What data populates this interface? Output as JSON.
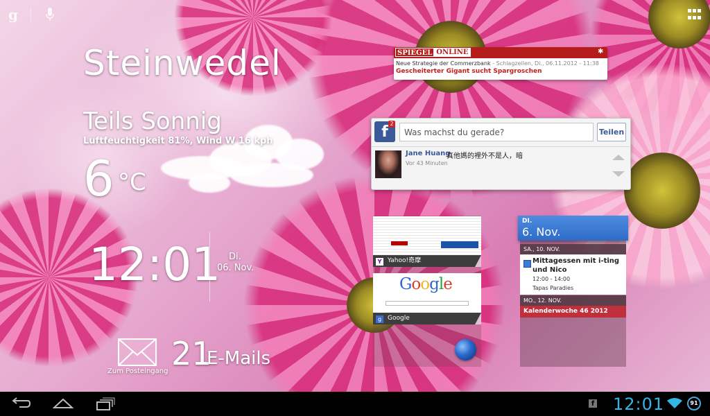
{
  "weather": {
    "city": "Steinwedel",
    "condition": "Teils Sonnig",
    "details": "Luftfeuchtigkeit 81%, Wind W 16 kph",
    "temperature": "6",
    "unit": "°C"
  },
  "clock": {
    "time": "12:01",
    "day": "Di.",
    "date": "06. Nov."
  },
  "mail": {
    "count": "21",
    "label": "E-Mails",
    "inbox_label": "Zum Posteingang"
  },
  "spiegel": {
    "logo_left": "SPIEGEL",
    "logo_right": "ONLINE",
    "meta_title": "Neue Strategie der Commerzbank",
    "meta_info": " - Schlagzeilen, Di., 06.11.2012 - 11:38",
    "headline": "Gescheiterter Gigant sucht Spargroschen"
  },
  "facebook": {
    "logo": "f",
    "badge": "2",
    "placeholder": "Was machst du gerade?",
    "share_label": "Teilen",
    "post_author": "Jane Huang",
    "post_text": "真他媽的裡外不是人，暗",
    "post_time": "Vor 43 Minuten"
  },
  "bookmarks": [
    {
      "label": "Yahoo!奇摩",
      "icon": "Y"
    },
    {
      "label": "Google",
      "icon": "g"
    }
  ],
  "google_page": {
    "logo": "Google"
  },
  "calendar": {
    "header_day": "DI.",
    "header_date": "6. Nov.",
    "day1": "SA., 10. NOV.",
    "event_title": "Mittagessen mit i-ting und Nico",
    "event_time": "12:00 - 14:00",
    "event_place": "Tapas Paradies",
    "day2": "MO., 12. NOV.",
    "week_label": "Kalenderwoche 46 2012"
  },
  "status": {
    "time": "12:01",
    "battery": "91",
    "notification_icon": "f"
  },
  "colors": {
    "accent_blue": "#33b5e5",
    "spiegel_red": "#b51c1c",
    "facebook_blue": "#3b5998",
    "calendar_blue": "#3f7ad8",
    "calendar_red": "#c0303a"
  }
}
